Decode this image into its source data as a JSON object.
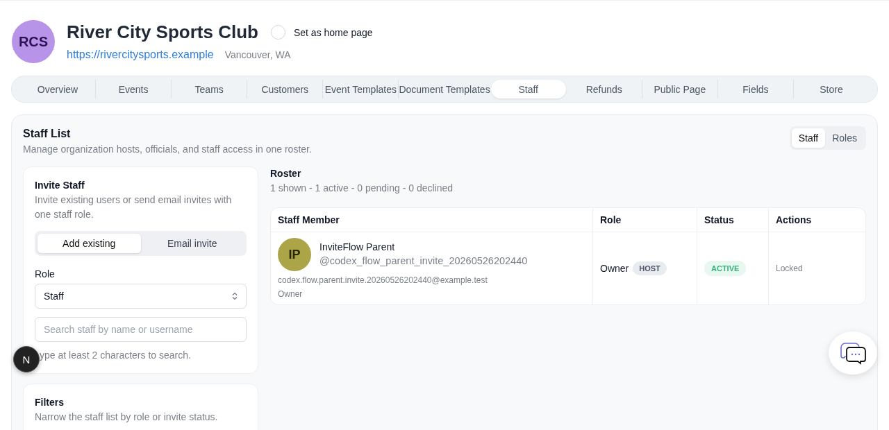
{
  "org": {
    "initials": "RCS",
    "name": "River City Sports Club",
    "home_page": {
      "label": "Set as home page",
      "checked": false
    },
    "url": "https://rivercitysports.example",
    "location": "Vancouver, WA"
  },
  "tabs": [
    {
      "label": "Overview",
      "selected": false
    },
    {
      "label": "Events",
      "selected": false
    },
    {
      "label": "Teams",
      "selected": false
    },
    {
      "label": "Customers",
      "selected": false
    },
    {
      "label": "Event Templates",
      "selected": false
    },
    {
      "label": "Document Templates",
      "selected": false
    },
    {
      "label": "Staff",
      "selected": true
    },
    {
      "label": "Refunds",
      "selected": false
    },
    {
      "label": "Public Page",
      "selected": false
    },
    {
      "label": "Fields",
      "selected": false
    },
    {
      "label": "Store",
      "selected": false
    }
  ],
  "panel": {
    "title": "Staff List",
    "subtitle": "Manage organization hosts, officials, and staff access in one roster.",
    "view_toggle": [
      {
        "label": "Staff",
        "selected": true
      },
      {
        "label": "Roles",
        "selected": false
      }
    ]
  },
  "invite": {
    "title": "Invite Staff",
    "description": "Invite existing users or send email invites with one staff role.",
    "modes": [
      {
        "label": "Add existing",
        "selected": true
      },
      {
        "label": "Email invite",
        "selected": false
      }
    ],
    "role_label": "Role",
    "role_value": "Staff",
    "search": {
      "placeholder": "Search staff by name or username"
    },
    "hint": "ype at least 2 characters to search."
  },
  "filters": {
    "title": "Filters",
    "description": "Narrow the staff list by role or invite status."
  },
  "roster": {
    "title": "Roster",
    "summary": "1 shown - 1 active - 0 pending - 0 declined",
    "columns": [
      "Staff Member",
      "Role",
      "Status",
      "Actions"
    ],
    "rows": [
      {
        "initials": "IP",
        "name": "InviteFlow Parent",
        "username": "@codex_flow_parent_invite_20260526202440",
        "email": "codex.flow.parent.invite.20260526202440@example.test",
        "role_note": "Owner",
        "role": "Owner",
        "role_tag": "HOST",
        "status": "ACTIVE",
        "action": "Locked"
      }
    ]
  },
  "dev_badge": "N"
}
